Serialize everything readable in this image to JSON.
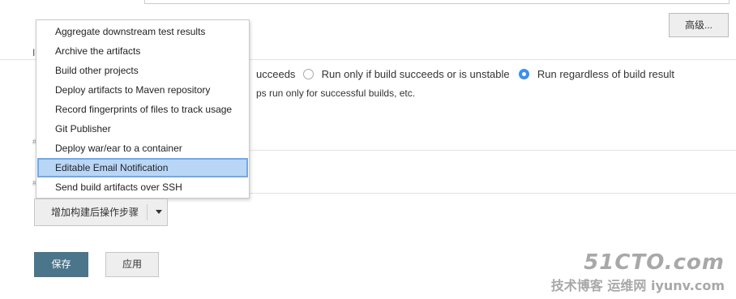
{
  "advanced_button": "高级...",
  "run_options": {
    "partial_left": "ucceeds",
    "option_stable_or_unstable": "Run only if build succeeds or is unstable",
    "option_regardless": "Run regardless of build result",
    "selected": "option_regardless"
  },
  "help_text_partial": "ps run only for successful builds, etc.",
  "menu": {
    "items": [
      "Aggregate downstream test results",
      "Archive the artifacts",
      "Build other projects",
      "Deploy artifacts to Maven repository",
      "Record fingerprints of files to track usage",
      "Git Publisher",
      "Deploy war/ear to a container",
      "Editable Email Notification",
      "Send build artifacts over SSH"
    ],
    "highlighted_index": 7
  },
  "add_post_build_step_button": "增加构建后操作步骤",
  "save_button": "保存",
  "apply_button": "应用",
  "watermark": {
    "main": "51CTO.com",
    "sub": "技术博客",
    "overlay": "运维网",
    "site": "iyunv.com"
  },
  "colors": {
    "primary_button": "#4b758b",
    "highlight": "#b9d6f6",
    "radio_checked": "#3b8ff2"
  }
}
